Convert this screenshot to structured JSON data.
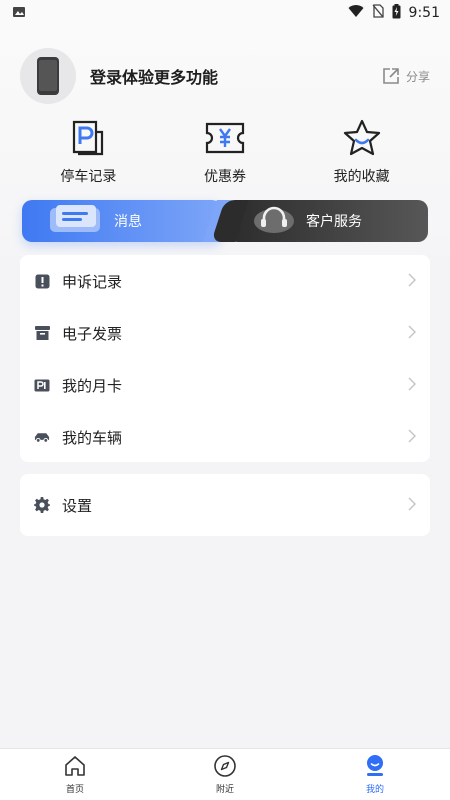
{
  "status_bar": {
    "time": "9:51"
  },
  "profile": {
    "login_text": "登录体验更多功能",
    "share_label": "分享"
  },
  "quick_actions": [
    {
      "label": "停车记录",
      "icon": "parking-record-icon"
    },
    {
      "label": "优惠券",
      "icon": "coupon-icon"
    },
    {
      "label": "我的收藏",
      "icon": "favorite-star-icon"
    }
  ],
  "tabs": {
    "messages": "消息",
    "service": "客户服务"
  },
  "menu": [
    {
      "label": "申诉记录",
      "icon": "appeal-icon"
    },
    {
      "label": "电子发票",
      "icon": "invoice-icon"
    },
    {
      "label": "我的月卡",
      "icon": "monthly-card-icon"
    },
    {
      "label": "我的车辆",
      "icon": "car-icon"
    }
  ],
  "settings": {
    "label": "设置",
    "icon": "gear-icon"
  },
  "bottom_nav": {
    "home": "首页",
    "nearby": "附近",
    "mine": "我的"
  },
  "colors": {
    "accent": "#2f6ef5",
    "dark_tab": "#2c2c2c"
  }
}
